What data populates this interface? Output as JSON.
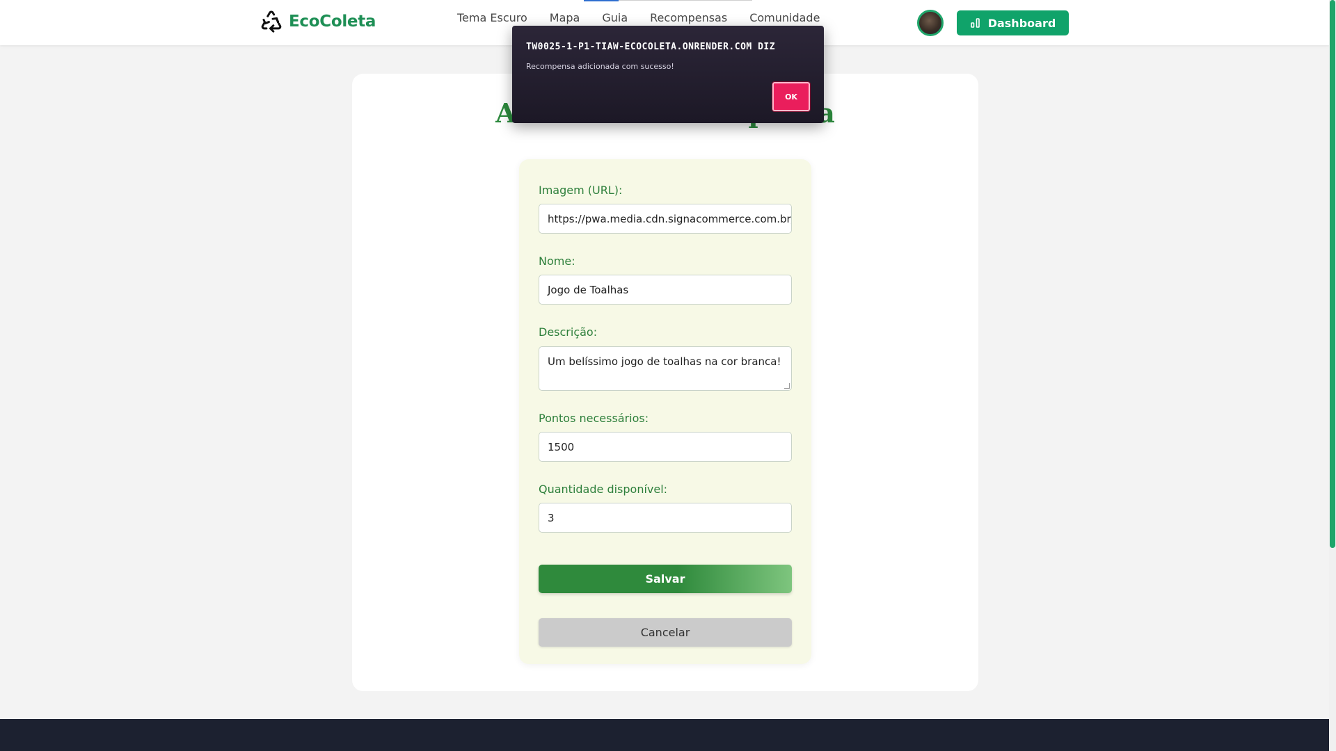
{
  "header": {
    "logo_text": "EcoColeta",
    "logo_icon": "recycle-icon",
    "nav": [
      "Tema Escuro",
      "Mapa",
      "Guia",
      "Recompensas",
      "Comunidade"
    ],
    "dashboard_label": "Dashboard",
    "dashboard_icon": "bar-chart-icon"
  },
  "page": {
    "title": "Adicionar Recompensa"
  },
  "form": {
    "image_label": "Imagem (URL):",
    "image_value": "https://pwa.media.cdn.signacommerce.com.br/c",
    "name_label": "Nome:",
    "name_value": "Jogo de Toalhas",
    "description_label": "Descrição:",
    "description_value": "Um belíssimo jogo de toalhas na cor branca!",
    "points_label": "Pontos necessários:",
    "points_value": "1500",
    "quantity_label": "Quantidade disponível:",
    "quantity_value": "3",
    "save_label": "Salvar",
    "cancel_label": "Cancelar"
  },
  "dialog": {
    "title": "TW0025-1-P1-TIAW-ECOCOLETA.ONRENDER.COM DIZ",
    "message": "Recompensa adicionada com sucesso!",
    "ok_label": "OK"
  },
  "colors": {
    "brand_green": "#1e8f55",
    "dashboard_button": "#10a36a",
    "form_background": "#f7f9e6",
    "dialog_ok": "#ea1e5c",
    "footer": "#1c2130"
  }
}
